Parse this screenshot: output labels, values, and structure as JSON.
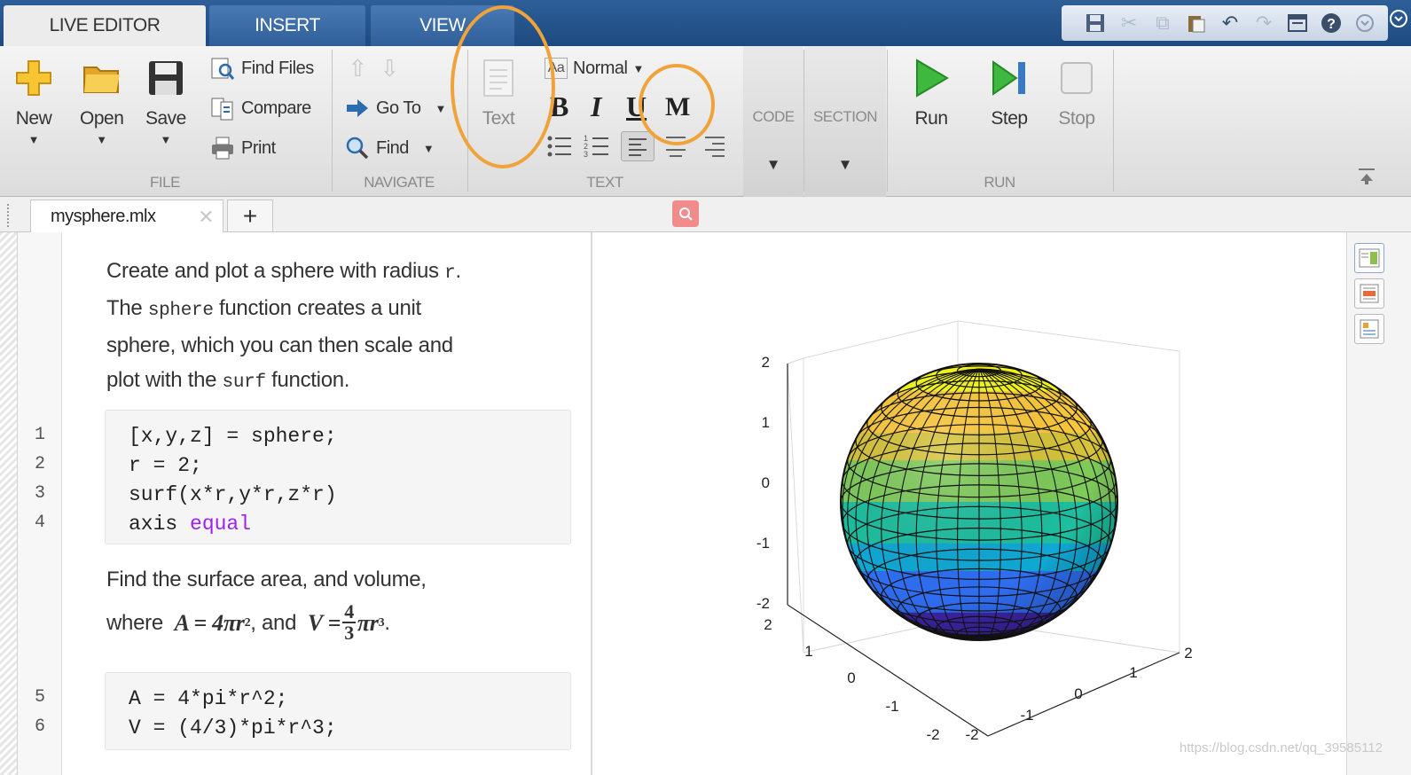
{
  "tabs": {
    "live_editor": "LIVE EDITOR",
    "insert": "INSERT",
    "view": "VIEW"
  },
  "ribbon": {
    "file": {
      "label": "FILE",
      "new": "New",
      "open": "Open",
      "save": "Save",
      "find_files": "Find Files",
      "compare": "Compare",
      "print": "Print"
    },
    "navigate": {
      "label": "NAVIGATE",
      "go_to": "Go To",
      "find": "Find"
    },
    "text": {
      "label": "TEXT",
      "text_button": "Text",
      "style": "Normal",
      "bold": "B",
      "italic": "I",
      "underline": "U",
      "monospace": "M"
    },
    "code": {
      "label": "CODE"
    },
    "section": {
      "label": "SECTION"
    },
    "run": {
      "label": "RUN",
      "run": "Run",
      "step": "Step",
      "stop": "Stop"
    }
  },
  "document": {
    "tab_name": "mysphere.mlx"
  },
  "editor": {
    "para1": [
      "Create and plot a sphere with radius ",
      "r",
      ".",
      "The ",
      "sphere",
      " function creates a unit",
      "sphere, which you can then scale and",
      "plot with the ",
      "surf",
      " function."
    ],
    "code1": [
      {
        "num": "1",
        "text": "[x,y,z] = sphere;"
      },
      {
        "num": "2",
        "text": "r = 2;"
      },
      {
        "num": "3",
        "text": "surf(x*r,y*r,z*r)"
      },
      {
        "num": "4",
        "text": "axis ",
        "kw": "equal"
      }
    ],
    "para2_line1": "Find the surface area, and volume,",
    "para2_where": "where",
    "para2_A": "A = 4πr",
    "para2_and": ", and",
    "para2_V": "V =",
    "para2_num": "4",
    "para2_den": "3",
    "para2_tail": "πr",
    "code2": [
      {
        "num": "5",
        "text": "A = 4*pi*r^2;"
      },
      {
        "num": "6",
        "text": "V = (4/3)*pi*r^3;"
      }
    ]
  },
  "chart_data": {
    "type": "surface",
    "title": "",
    "zticks": [
      "2",
      "1",
      "0",
      "-1",
      "-2"
    ],
    "xticks": [
      "2",
      "1",
      "0",
      "-1",
      "-2"
    ],
    "yticks": [
      "2",
      "1",
      "0",
      "-1",
      "-2"
    ],
    "zlim": [
      -2,
      2
    ],
    "colormap": [
      "#3e26a8",
      "#2f6ef2",
      "#0fa8d4",
      "#1dbfa0",
      "#7fcb5a",
      "#d7c43a",
      "#fcc93a",
      "#f9fb15"
    ]
  },
  "watermark": "https://blog.csdn.net/qq_39585112",
  "colors": {
    "accent": "#1d4a80",
    "highlight": "#f0a33a"
  }
}
